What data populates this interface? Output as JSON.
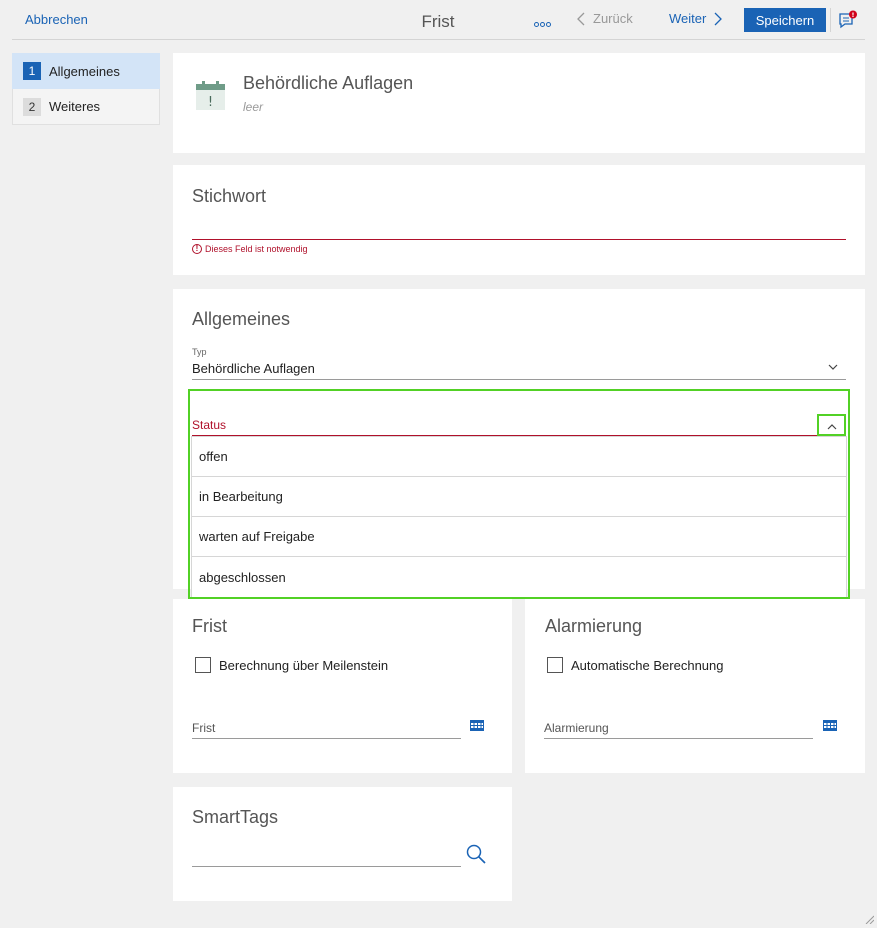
{
  "header": {
    "cancel_label": "Abbrechen",
    "title": "Frist",
    "more_icon": "more-dots-icon",
    "prev_label": "Zurück",
    "next_label": "Weiter",
    "save_label": "Speichern",
    "notification_icon": "chat-alert-icon"
  },
  "sidebar": {
    "items": [
      {
        "num": "1",
        "label": "Allgemeines"
      },
      {
        "num": "2",
        "label": "Weiteres"
      }
    ]
  },
  "object": {
    "title": "Behördliche Auflagen",
    "subtitle": "leer",
    "icon": "calendar-alert-icon"
  },
  "stichwort": {
    "title": "Stichwort",
    "error": "Dieses Feld ist notwendig"
  },
  "allgemeines": {
    "title": "Allgemeines",
    "typ_label": "Typ",
    "typ_value": "Behördliche Auflagen",
    "status_label": "Status",
    "status_options": [
      "offen",
      "in Bearbeitung",
      "warten auf Freigabe",
      "abgeschlossen"
    ]
  },
  "frist": {
    "title": "Frist",
    "checkbox_label": "Berechnung über Meilenstein",
    "field_placeholder": "Frist"
  },
  "alarmierung": {
    "title": "Alarmierung",
    "checkbox_label": "Automatische Berechnung",
    "field_placeholder": "Alarmierung"
  },
  "smarttags": {
    "title": "SmartTags"
  },
  "colors": {
    "accent": "#1a63b5",
    "error": "#b0112b",
    "highlight": "#52d125",
    "active_nav": "#d3e4f7"
  }
}
